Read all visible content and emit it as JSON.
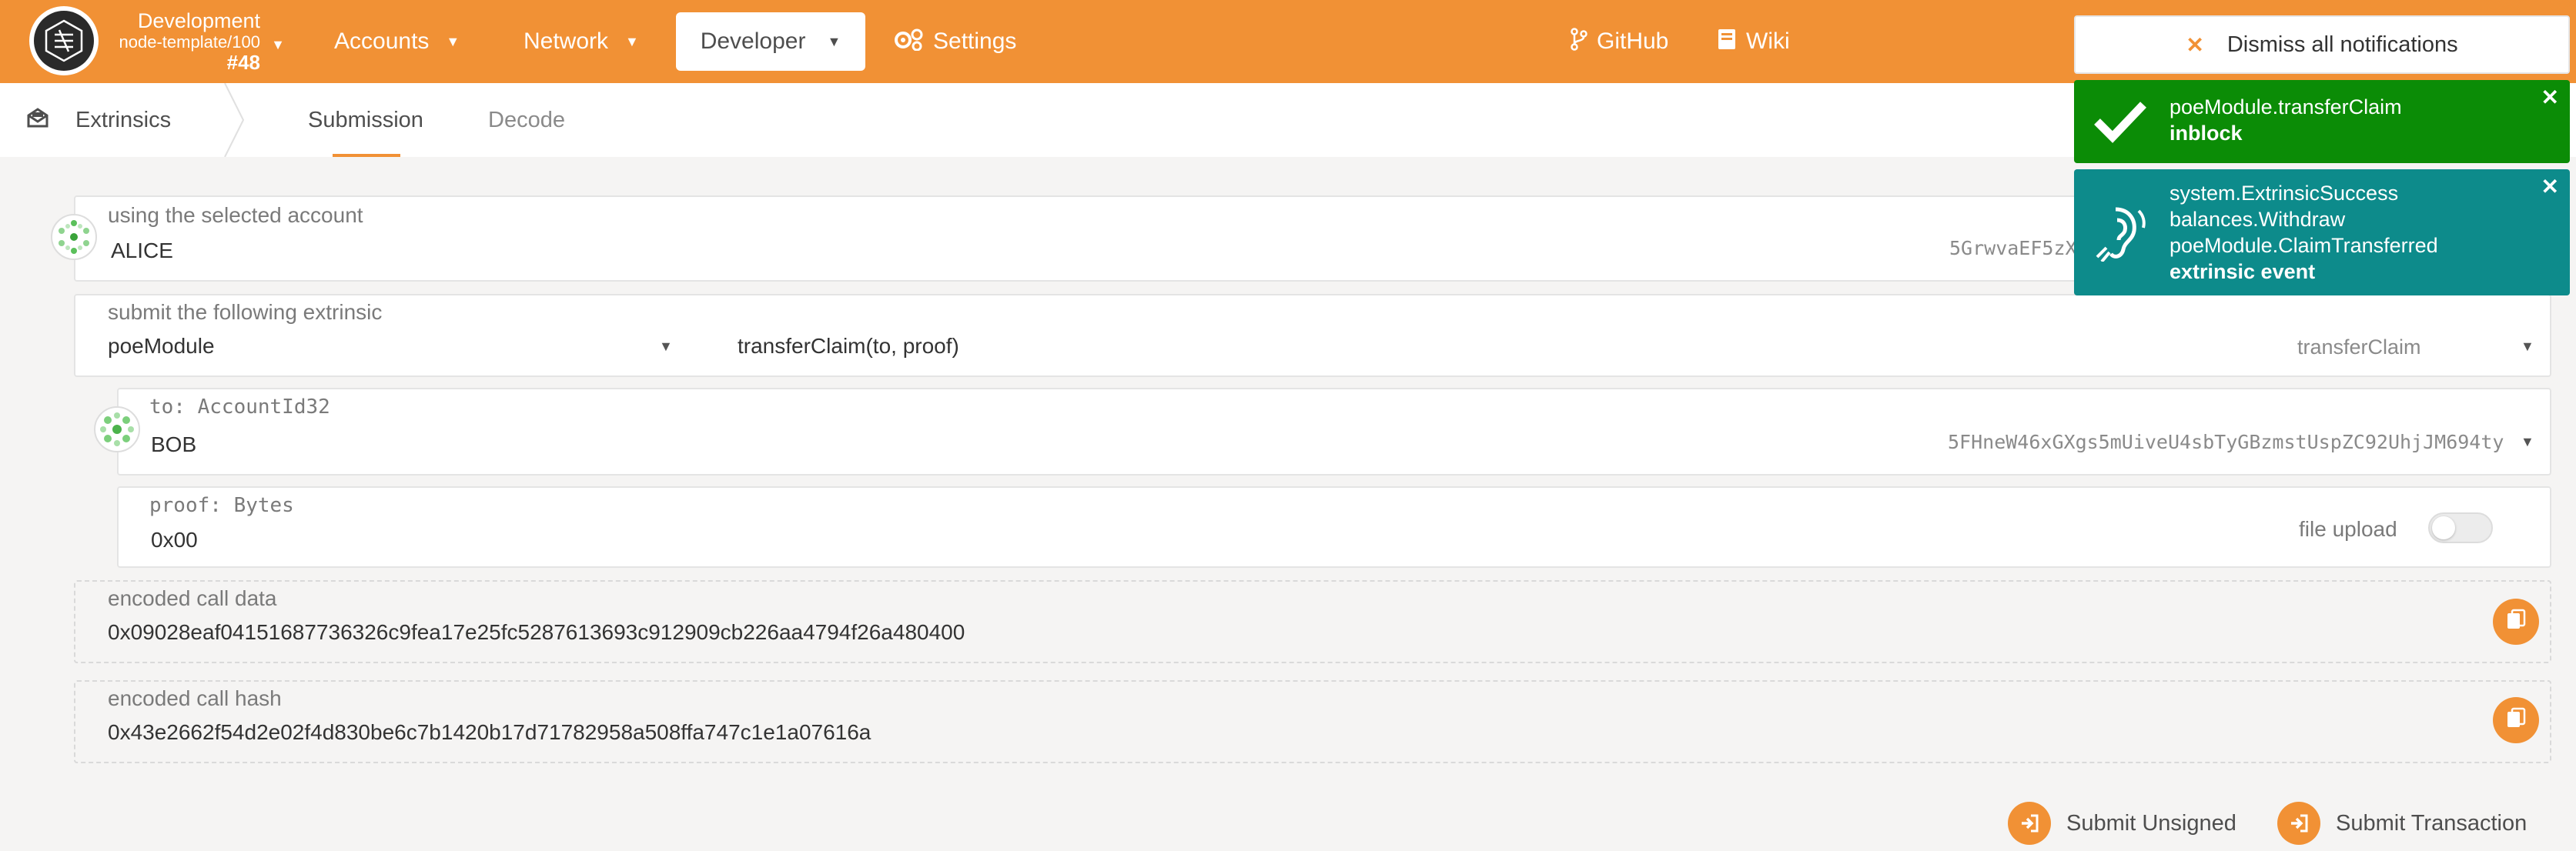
{
  "colors": {
    "brand": "#f19135",
    "success": "#0b8c06",
    "event": "#0d8b8b"
  },
  "chain": {
    "name": "Development",
    "node": "node-template/100",
    "block": "#48"
  },
  "nav": {
    "accounts": "Accounts",
    "network": "Network",
    "developer": "Developer",
    "settings": "Settings",
    "github": "GitHub",
    "wiki": "Wiki"
  },
  "subnav": {
    "section": "Extrinsics",
    "tabs": [
      "Submission",
      "Decode"
    ]
  },
  "form": {
    "account_label": "using the selected account",
    "account_name": "ALICE",
    "account_address": "5GrwvaEF5zX",
    "extrinsic_label": "submit the following extrinsic",
    "module": "poeModule",
    "call_signature": "transferClaim(to, proof)",
    "call_name": "transferClaim",
    "to_label": "to: AccountId32",
    "to_name": "BOB",
    "to_address": "5FHneW46xGXgs5mUiveU4sbTyGBzmstUspZC92UhjJM694ty",
    "proof_label": "proof: Bytes",
    "proof_value": "0x00",
    "file_upload_label": "file upload",
    "file_upload_on": false,
    "call_data_label": "encoded call data",
    "call_data": "0x09028eaf04151687736326c9fea17e25fc5287613693c912909cb226aa4794f26a480400",
    "call_hash_label": "encoded call hash",
    "call_hash": "0x43e2662f54d2e02f4d830be6c7b1420b17d71782958a508ffa747c1e1a07616a"
  },
  "actions": {
    "submit_unsigned": "Submit Unsigned",
    "submit_transaction": "Submit Transaction"
  },
  "notifications": {
    "dismiss_all": "Dismiss all notifications",
    "items": [
      {
        "lines": [
          "poeModule.transferClaim"
        ],
        "status": "inblock",
        "icon": "check-icon"
      },
      {
        "lines": [
          "system.ExtrinsicSuccess",
          "balances.Withdraw",
          "poeModule.ClaimTransferred"
        ],
        "status": "extrinsic event",
        "icon": "ear-icon"
      }
    ]
  }
}
